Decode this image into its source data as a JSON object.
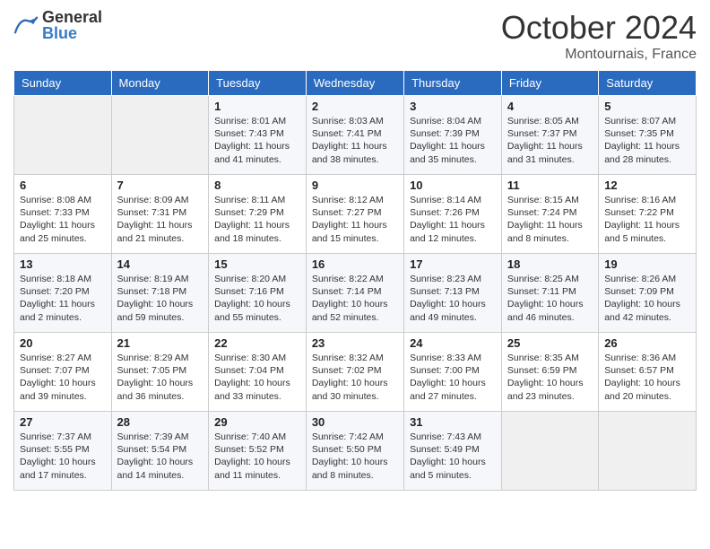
{
  "logo": {
    "general": "General",
    "blue": "Blue"
  },
  "header": {
    "month": "October 2024",
    "location": "Montournais, France"
  },
  "weekdays": [
    "Sunday",
    "Monday",
    "Tuesday",
    "Wednesday",
    "Thursday",
    "Friday",
    "Saturday"
  ],
  "weeks": [
    [
      {
        "day": null,
        "info": ""
      },
      {
        "day": null,
        "info": ""
      },
      {
        "day": "1",
        "info": "Sunrise: 8:01 AM\nSunset: 7:43 PM\nDaylight: 11 hours and 41 minutes."
      },
      {
        "day": "2",
        "info": "Sunrise: 8:03 AM\nSunset: 7:41 PM\nDaylight: 11 hours and 38 minutes."
      },
      {
        "day": "3",
        "info": "Sunrise: 8:04 AM\nSunset: 7:39 PM\nDaylight: 11 hours and 35 minutes."
      },
      {
        "day": "4",
        "info": "Sunrise: 8:05 AM\nSunset: 7:37 PM\nDaylight: 11 hours and 31 minutes."
      },
      {
        "day": "5",
        "info": "Sunrise: 8:07 AM\nSunset: 7:35 PM\nDaylight: 11 hours and 28 minutes."
      }
    ],
    [
      {
        "day": "6",
        "info": "Sunrise: 8:08 AM\nSunset: 7:33 PM\nDaylight: 11 hours and 25 minutes."
      },
      {
        "day": "7",
        "info": "Sunrise: 8:09 AM\nSunset: 7:31 PM\nDaylight: 11 hours and 21 minutes."
      },
      {
        "day": "8",
        "info": "Sunrise: 8:11 AM\nSunset: 7:29 PM\nDaylight: 11 hours and 18 minutes."
      },
      {
        "day": "9",
        "info": "Sunrise: 8:12 AM\nSunset: 7:27 PM\nDaylight: 11 hours and 15 minutes."
      },
      {
        "day": "10",
        "info": "Sunrise: 8:14 AM\nSunset: 7:26 PM\nDaylight: 11 hours and 12 minutes."
      },
      {
        "day": "11",
        "info": "Sunrise: 8:15 AM\nSunset: 7:24 PM\nDaylight: 11 hours and 8 minutes."
      },
      {
        "day": "12",
        "info": "Sunrise: 8:16 AM\nSunset: 7:22 PM\nDaylight: 11 hours and 5 minutes."
      }
    ],
    [
      {
        "day": "13",
        "info": "Sunrise: 8:18 AM\nSunset: 7:20 PM\nDaylight: 11 hours and 2 minutes."
      },
      {
        "day": "14",
        "info": "Sunrise: 8:19 AM\nSunset: 7:18 PM\nDaylight: 10 hours and 59 minutes."
      },
      {
        "day": "15",
        "info": "Sunrise: 8:20 AM\nSunset: 7:16 PM\nDaylight: 10 hours and 55 minutes."
      },
      {
        "day": "16",
        "info": "Sunrise: 8:22 AM\nSunset: 7:14 PM\nDaylight: 10 hours and 52 minutes."
      },
      {
        "day": "17",
        "info": "Sunrise: 8:23 AM\nSunset: 7:13 PM\nDaylight: 10 hours and 49 minutes."
      },
      {
        "day": "18",
        "info": "Sunrise: 8:25 AM\nSunset: 7:11 PM\nDaylight: 10 hours and 46 minutes."
      },
      {
        "day": "19",
        "info": "Sunrise: 8:26 AM\nSunset: 7:09 PM\nDaylight: 10 hours and 42 minutes."
      }
    ],
    [
      {
        "day": "20",
        "info": "Sunrise: 8:27 AM\nSunset: 7:07 PM\nDaylight: 10 hours and 39 minutes."
      },
      {
        "day": "21",
        "info": "Sunrise: 8:29 AM\nSunset: 7:05 PM\nDaylight: 10 hours and 36 minutes."
      },
      {
        "day": "22",
        "info": "Sunrise: 8:30 AM\nSunset: 7:04 PM\nDaylight: 10 hours and 33 minutes."
      },
      {
        "day": "23",
        "info": "Sunrise: 8:32 AM\nSunset: 7:02 PM\nDaylight: 10 hours and 30 minutes."
      },
      {
        "day": "24",
        "info": "Sunrise: 8:33 AM\nSunset: 7:00 PM\nDaylight: 10 hours and 27 minutes."
      },
      {
        "day": "25",
        "info": "Sunrise: 8:35 AM\nSunset: 6:59 PM\nDaylight: 10 hours and 23 minutes."
      },
      {
        "day": "26",
        "info": "Sunrise: 8:36 AM\nSunset: 6:57 PM\nDaylight: 10 hours and 20 minutes."
      }
    ],
    [
      {
        "day": "27",
        "info": "Sunrise: 7:37 AM\nSunset: 5:55 PM\nDaylight: 10 hours and 17 minutes."
      },
      {
        "day": "28",
        "info": "Sunrise: 7:39 AM\nSunset: 5:54 PM\nDaylight: 10 hours and 14 minutes."
      },
      {
        "day": "29",
        "info": "Sunrise: 7:40 AM\nSunset: 5:52 PM\nDaylight: 10 hours and 11 minutes."
      },
      {
        "day": "30",
        "info": "Sunrise: 7:42 AM\nSunset: 5:50 PM\nDaylight: 10 hours and 8 minutes."
      },
      {
        "day": "31",
        "info": "Sunrise: 7:43 AM\nSunset: 5:49 PM\nDaylight: 10 hours and 5 minutes."
      },
      {
        "day": null,
        "info": ""
      },
      {
        "day": null,
        "info": ""
      }
    ]
  ]
}
